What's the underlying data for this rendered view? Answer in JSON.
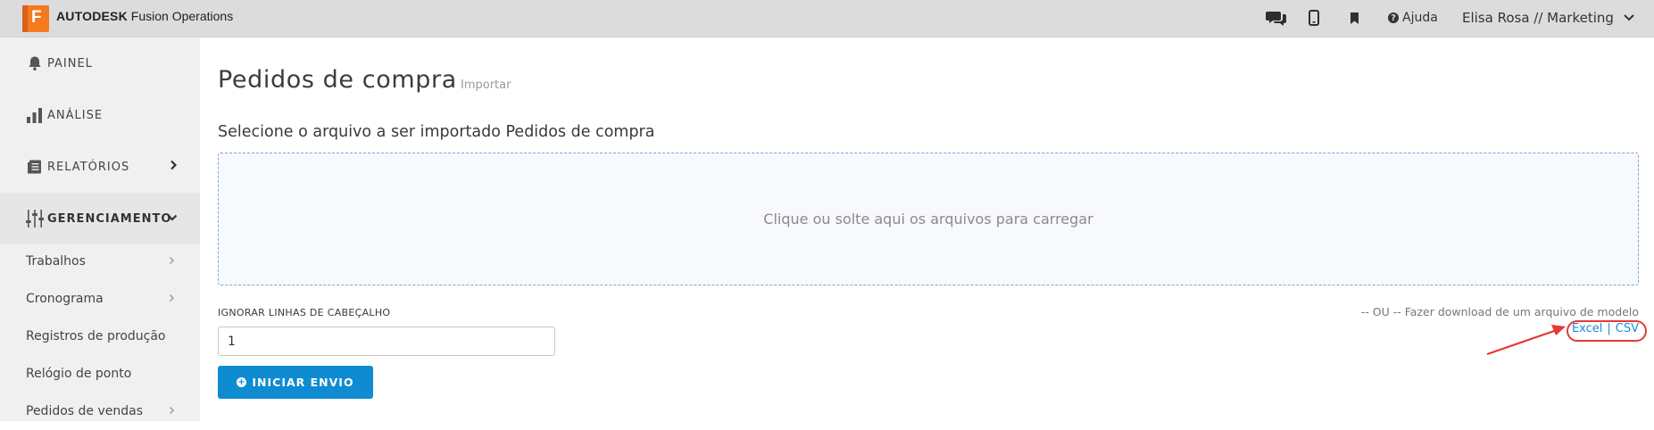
{
  "app": {
    "logo_letter": "F",
    "brand_bold": "AUTODESK",
    "brand_rest": "Fusion Operations"
  },
  "topbar": {
    "help_label": "Ajuda",
    "user_label": "Elisa Rosa // Marketing",
    "icons": [
      "chat-icon",
      "mobile-icon",
      "bookmark-icon",
      "help-icon",
      "chevron-down-icon"
    ]
  },
  "sidebar": {
    "items": [
      {
        "label": "PAINEL",
        "icon": "bell-icon"
      },
      {
        "label": "ANÁLISE",
        "icon": "bar-chart-icon"
      },
      {
        "label": "RELATÓRIOS",
        "icon": "report-icon"
      },
      {
        "label": "GERENCIAMENTO",
        "icon": "sliders-icon"
      }
    ],
    "sub_items": [
      {
        "label": "Trabalhos",
        "has_chevron": true
      },
      {
        "label": "Cronograma",
        "has_chevron": true
      },
      {
        "label": "Registros de produção",
        "has_chevron": false
      },
      {
        "label": "Relógio de ponto",
        "has_chevron": false
      },
      {
        "label": "Pedidos de vendas",
        "has_chevron": true
      }
    ]
  },
  "main": {
    "title": "Pedidos de compra",
    "title_sub": "Importar",
    "section_label": "Selecione o arquivo a ser importado Pedidos de compra",
    "dropzone_text": "Clique ou solte aqui os arquivos para carregar",
    "ignore_label": "IGNORAR LINHAS DE CABEÇALHO",
    "ignore_value": "1",
    "start_button": "INICIAR ENVIO",
    "or_text": "-- OU -- Fazer download de um arquivo de modelo",
    "link_excel": "Excel",
    "link_sep": "|",
    "link_csv": "CSV"
  },
  "colors": {
    "accent": "#0f8bd2",
    "logo": "#f47a20",
    "annotation": "#e53935"
  }
}
